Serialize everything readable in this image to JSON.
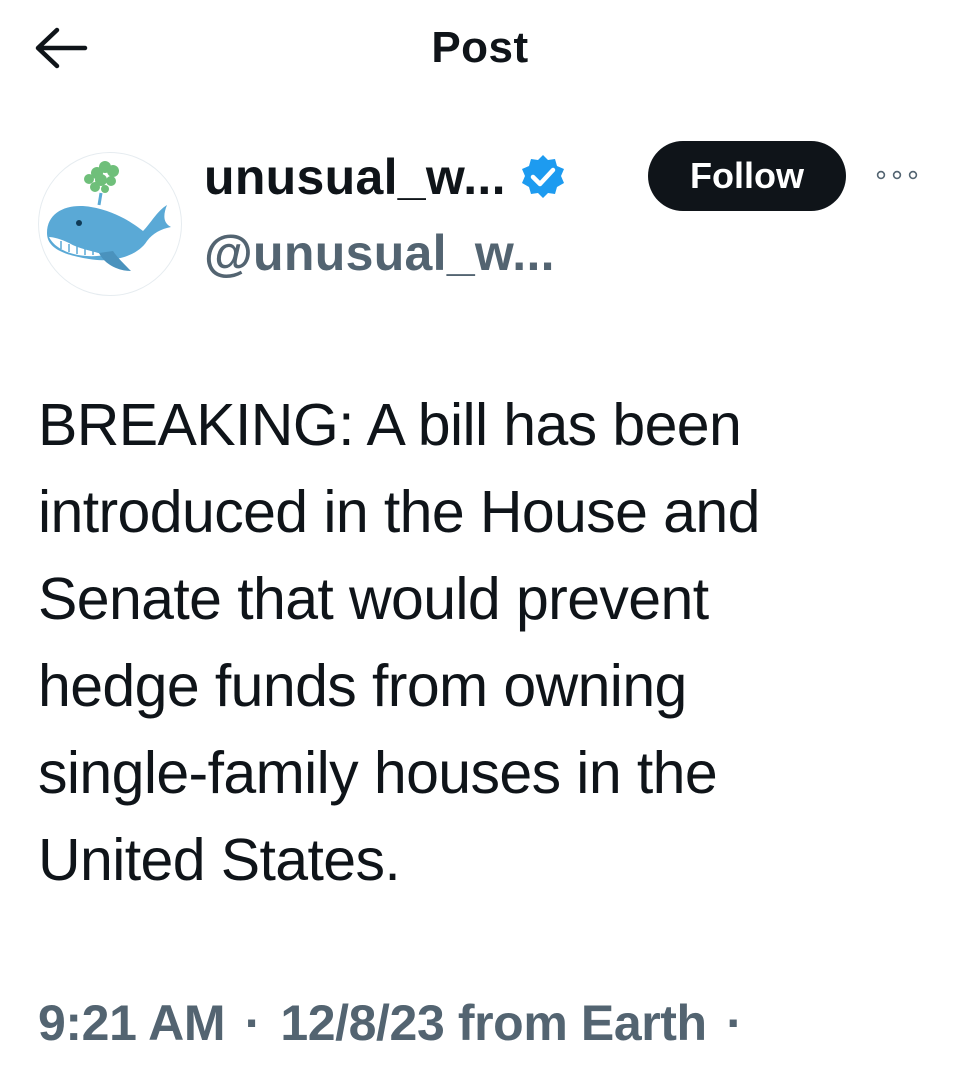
{
  "header": {
    "title": "Post",
    "back_icon": "arrow-left-icon"
  },
  "author": {
    "display_name": "unusual_w...",
    "handle": "@unusual_w...",
    "verified": true,
    "verified_icon": "verified-badge-icon",
    "avatar_icon": "whale-avatar",
    "follow_label": "Follow",
    "more_icon": "more-dots-icon"
  },
  "post": {
    "text": "BREAKING: A bill has been\nintroduced in the House and\nSenate that would prevent\nhedge funds from owning\nsingle-family houses in the\nUnited States."
  },
  "meta": {
    "time": "9:21 AM",
    "separator": "·",
    "date": "12/8/23",
    "source": "from Earth"
  },
  "colors": {
    "text": "#0f1419",
    "secondary": "#536471",
    "verified": "#1d9bf0",
    "follow_bg": "#0f1419",
    "follow_text": "#ffffff"
  }
}
